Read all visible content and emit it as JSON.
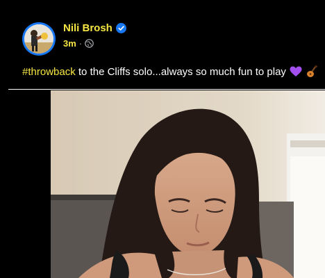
{
  "post": {
    "author": "Nili Brosh",
    "time": "3m",
    "separator": "·",
    "caption_hashtag": "#throwback",
    "caption_text": " to the Cliffs solo...always so much fun to play",
    "emojis": [
      "purple-heart-icon",
      "guitar-icon"
    ]
  },
  "colors": {
    "name": "#f5e642",
    "accent": "#1877f2",
    "background": "#000000"
  }
}
